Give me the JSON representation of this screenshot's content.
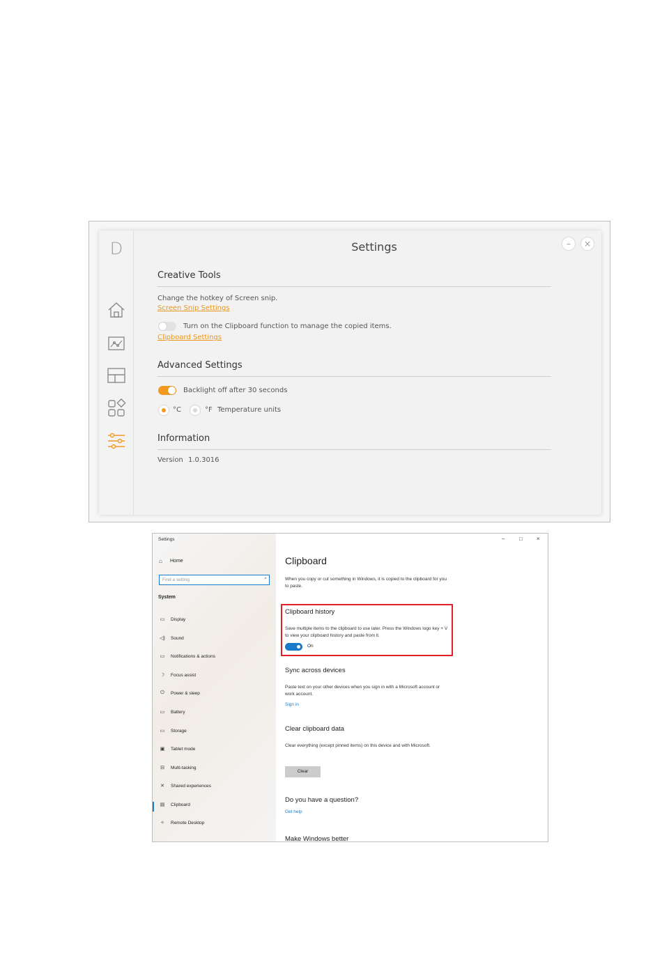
{
  "dell_app": {
    "logo": "D",
    "title": "Settings",
    "minimize": "–",
    "close": "×",
    "nav": [
      {
        "name": "home",
        "icon": "home-icon"
      },
      {
        "name": "display",
        "icon": "image-icon"
      },
      {
        "name": "layout",
        "icon": "layout-icon"
      },
      {
        "name": "apps",
        "icon": "apps-icon"
      },
      {
        "name": "settings",
        "icon": "sliders-icon",
        "active": true
      }
    ],
    "creative_tools": {
      "title": "Creative Tools",
      "hotkey_text": "Change the hotkey of Screen snip.",
      "snip_link": "Screen Snip Settings",
      "clipboard_text": "Turn on the Clipboard function to manage the copied items.",
      "clipboard_link": "Clipboard Settings"
    },
    "advanced": {
      "title": "Advanced Settings",
      "backlight_text": "Backlight off after 30 seconds",
      "celsius": "°C",
      "fahrenheit": "°F",
      "temp_text": "Temperature units"
    },
    "information": {
      "title": "Information",
      "version_label": "Version",
      "version_value": "1.0.3016"
    },
    "accent": "#f29a1f"
  },
  "windows": {
    "window_title": "Settings",
    "controls": [
      "–",
      "□",
      "×"
    ],
    "home": "Home",
    "search_placeholder": "Find a setting",
    "section": "System",
    "nav": [
      {
        "icon": "▭",
        "label": "Display"
      },
      {
        "icon": "◁)",
        "label": "Sound"
      },
      {
        "icon": "▭",
        "label": "Notifications & actions"
      },
      {
        "icon": "☽",
        "label": "Focus assist"
      },
      {
        "icon": "⏻",
        "label": "Power & sleep"
      },
      {
        "icon": "▭",
        "label": "Battery"
      },
      {
        "icon": "▭",
        "label": "Storage"
      },
      {
        "icon": "▣",
        "label": "Tablet mode"
      },
      {
        "icon": "⊟",
        "label": "Multi-tasking"
      },
      {
        "icon": "✕",
        "label": "Shared experiences"
      },
      {
        "icon": "▤",
        "label": "Clipboard"
      },
      {
        "icon": "✧",
        "label": "Remote Desktop"
      }
    ],
    "page_title": "Clipboard",
    "intro": "When you copy or cut something in Windows, it is copied to the clipboard for you to paste.",
    "history_title": "Clipboard history",
    "history_text": "Save multiple items to the clipboard to use later. Press the Windows logo key + V to view your clipboard history and paste from it.",
    "history_state": "On",
    "sync_title": "Sync across devices",
    "sync_text": "Paste text on your other devices when you sign in with a Microsoft account or work account.",
    "sync_link": "Sign in",
    "clear_title": "Clear clipboard data",
    "clear_text": "Clear everything (except pinned items) on this device and with Microsoft.",
    "clear_button": "Clear",
    "question_title": "Do you have a question?",
    "help_link": "Get help",
    "better_title": "Make Windows better",
    "highlight_color": "#e21f26",
    "accent": "#1979ca"
  }
}
